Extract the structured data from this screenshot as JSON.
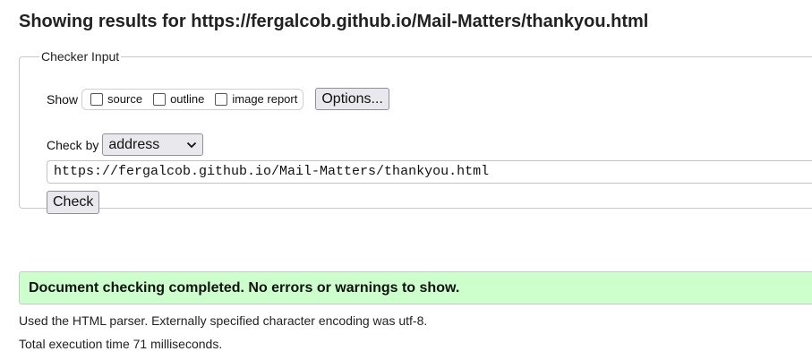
{
  "heading": {
    "prefix": "Showing results for",
    "url": "https://fergalcob.github.io/Mail-Matters/thankyou.html"
  },
  "checker_input": {
    "legend": "Checker Input",
    "show_label": "Show",
    "options": [
      {
        "label": "source",
        "checked": false
      },
      {
        "label": "outline",
        "checked": false
      },
      {
        "label": "image report",
        "checked": false
      }
    ],
    "options_button": "Options...",
    "check_by_label": "Check by",
    "check_by_value": "address",
    "url_value": "https://fergalcob.github.io/Mail-Matters/thankyou.html",
    "check_button": "Check"
  },
  "result": {
    "success_message": "Document checking completed. No errors or warnings to show.",
    "success_color": "#ccffcc",
    "parser_info": "Used the HTML parser. Externally specified character encoding was utf-8.",
    "execution_time": "Total execution time 71 milliseconds."
  }
}
